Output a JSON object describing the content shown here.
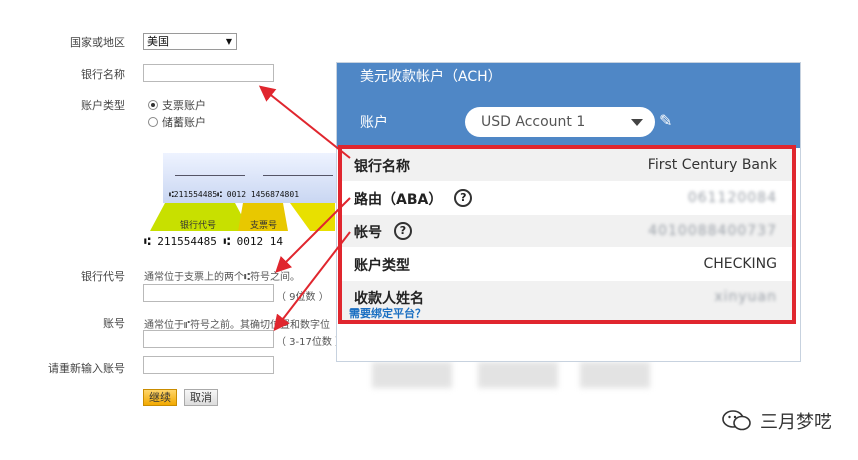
{
  "form": {
    "country_label": "国家或地区",
    "country_value": "美国",
    "bank_name_label": "银行名称",
    "account_type_label": "账户类型",
    "account_type_options": [
      "支票账户",
      "储蓄账户"
    ],
    "routing_label": "银行代号",
    "routing_hint": "通常位于支票上的两个⑆符号之间。",
    "routing_digits": "（ 9位数 ）",
    "account_label": "账号",
    "account_hint": "通常位于⑈符号之前。其确切位置和数字位",
    "account_digits": "（ 3-17位数 ）",
    "reenter_label": "请重新输入账号",
    "continue_button": "继续",
    "cancel_button": "取消"
  },
  "cheque": {
    "micr_top": "⑆211554485⑆   0012   1456874801",
    "micr_bottom": "⑆ 211554485 ⑆    0012      14",
    "band_routing": "银行代号",
    "band_check": "支票号"
  },
  "panel": {
    "title": "美元收款帐户（ACH）",
    "account_label": "账户",
    "account_selected": "USD Account 1",
    "rows": [
      {
        "key": "银行名称",
        "value": "First Century Bank",
        "masked": false,
        "help": false
      },
      {
        "key": "路由（ABA）",
        "value": "061120084",
        "masked": true,
        "help": true
      },
      {
        "key": "帐号",
        "value": "4010088400737",
        "masked": true,
        "help": true
      },
      {
        "key": "账户类型",
        "value": "CHECKING",
        "masked": false,
        "help": false
      },
      {
        "key": "收款人姓名",
        "value": "xinyuan",
        "masked": true,
        "help": false
      }
    ],
    "link": "需要绑定平台？"
  },
  "watermark": {
    "text": "三月梦呓",
    "icon": "wechat-icon"
  },
  "colors": {
    "panel_header": "#4f87c6",
    "highlight_red": "#e0262e",
    "link_blue": "#1a6fc2",
    "continue_button": "#f2a900"
  }
}
